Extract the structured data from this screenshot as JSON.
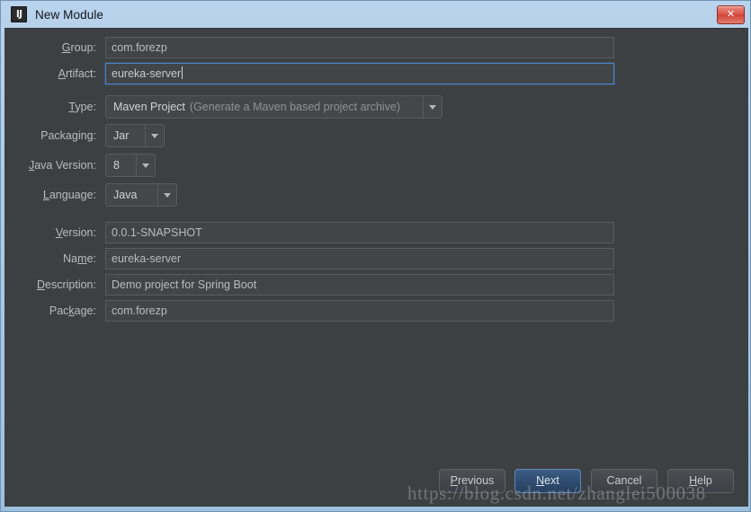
{
  "window": {
    "title": "New Module",
    "app_icon": "IJ",
    "close_label": "✕",
    "accent_blue": "#4a86c8",
    "title_bar_color": "#aecce6",
    "body_color": "#3c4043"
  },
  "form": {
    "fields": [
      {
        "label": "Group",
        "mnemonic": "G",
        "value": "com.forezp",
        "focused": false
      },
      {
        "label": "Artifact",
        "mnemonic": "A",
        "value": "eureka-server",
        "focused": true
      },
      {
        "label": "Version",
        "mnemonic": "V",
        "value": "0.0.1-SNAPSHOT",
        "focused": false
      },
      {
        "label": "Name",
        "mnemonic": "m",
        "value": "eureka-server",
        "focused": false
      },
      {
        "label": "Description",
        "mnemonic": "D",
        "value": "Demo project for Spring Boot",
        "focused": false
      },
      {
        "label": "Package",
        "mnemonic": "k",
        "value": "com.forezp",
        "focused": false
      }
    ],
    "combos": [
      {
        "label": "Type",
        "mnemonic": "T",
        "value": "Maven Project",
        "hint": "(Generate a Maven based project archive)"
      },
      {
        "label": "Packaging",
        "mnemonic": "g",
        "value": "Jar",
        "hint": ""
      },
      {
        "label": "Java Version",
        "mnemonic": "J",
        "value": "8",
        "hint": ""
      },
      {
        "label": "Language",
        "mnemonic": "L",
        "value": "Java",
        "hint": ""
      }
    ]
  },
  "buttons": {
    "previous": {
      "label": "Previous",
      "mnemonic": "P"
    },
    "next": {
      "label": "Next",
      "mnemonic": "N"
    },
    "cancel": {
      "label": "Cancel",
      "mnemonic": ""
    },
    "help": {
      "label": "Help",
      "mnemonic": "H"
    }
  },
  "watermark": {
    "text": "https://blog.csdn.net/zhanglei500038"
  }
}
